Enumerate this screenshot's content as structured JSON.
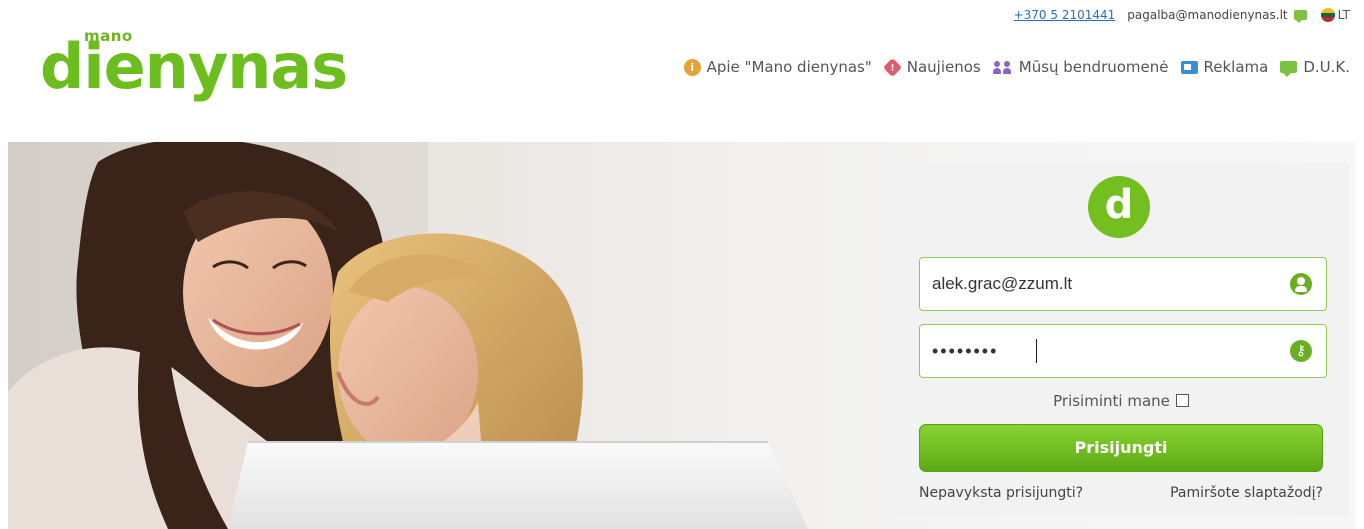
{
  "header": {
    "logo_small": "mano",
    "logo_main": "dienynas",
    "phone": "+370 5 2101441",
    "email": "pagalba@manodienynas.lt",
    "language": "LT"
  },
  "nav": [
    {
      "label": "Apie \"Mano dienynas\"",
      "icon": "info-icon"
    },
    {
      "label": "Naujienos",
      "icon": "news-icon"
    },
    {
      "label": "Mūsų bendruomenė",
      "icon": "community-icon"
    },
    {
      "label": "Reklama",
      "icon": "radio-icon"
    },
    {
      "label": "D.U.K.",
      "icon": "faq-icon"
    }
  ],
  "login": {
    "logo_letter": "d",
    "username_value": "alek.grac@zzum.lt",
    "password_value": "••••••••",
    "remember_label": "Prisiminti mane",
    "remember_checked": false,
    "submit_label": "Prisijungti",
    "link_cant_login": "Nepavyksta prisijungti?",
    "link_forgot": "Pamiršote slaptažodį?"
  },
  "colors": {
    "brand_green": "#6cbd1e",
    "accent_blue": "#2a6fb8"
  }
}
